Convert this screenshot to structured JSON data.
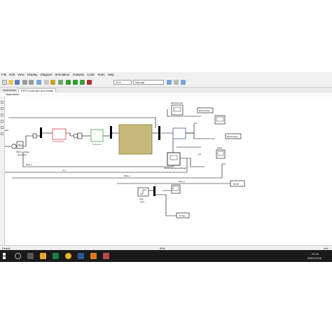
{
  "menu": [
    "File",
    "Edit",
    "View",
    "Display",
    "Diagram",
    "Simulation",
    "Analysis",
    "Code",
    "Tools",
    "Help"
  ],
  "toolbar": {
    "stop_time": "10.0",
    "sim_mode": "Normal"
  },
  "tabs": [
    "Hydromion",
    "PSO Controller and limiter"
  ],
  "breadcrumb": "Hydromion",
  "blocks": {
    "pid": "Pl(s)",
    "pid_caption": "PSO Controller\nand limiter",
    "transmission": "Transmission\nmodel",
    "sub2": "Subsystem",
    "sub2_caption": "Subsystem",
    "pmsm": "PMSM Mechanical Model",
    "step_caption": "Step\nInput",
    "scope_top_caption": "iabcCurrents",
    "mon1": "abcCurrents",
    "mon2": "abcCurrents",
    "speed_out": "speed",
    "torque_out": "Torque",
    "theta_a": "theta_a",
    "theta_e": "theta_e",
    "w_m": "w_m",
    "i_qs": "i_qs",
    "label_scope2": "Scope1",
    "label_scope3": "Scope"
  },
  "status": {
    "left": "Ready",
    "center": "96%",
    "right": "ode"
  },
  "taskbar": {
    "time": "23:15",
    "date": "25/01/2018"
  }
}
